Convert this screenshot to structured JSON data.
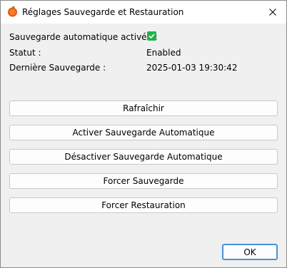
{
  "window": {
    "title": "Réglages Sauvegarde et Restauration",
    "app_icon": "orange-circle-icon",
    "close_icon": "close-icon"
  },
  "info": {
    "auto_backup_label": "Sauvegarde automatique activée :",
    "auto_backup_checked": true,
    "status_label": "Statut :",
    "status_value": "Enabled",
    "last_backup_label": "Dernière Sauvegarde :",
    "last_backup_value": "2025-01-03 19:30:42"
  },
  "buttons": {
    "refresh": "Rafraîchir",
    "enable_auto": "Activer Sauvegarde Automatique",
    "disable_auto": "Désactiver Sauvegarde Automatique",
    "force_backup": "Forcer Sauvegarde",
    "force_restore": "Forcer Restauration",
    "ok": "OK"
  },
  "colors": {
    "checkbox": "#22b14c",
    "app_icon": "#e8541c",
    "ok_border": "#4a90d9"
  }
}
